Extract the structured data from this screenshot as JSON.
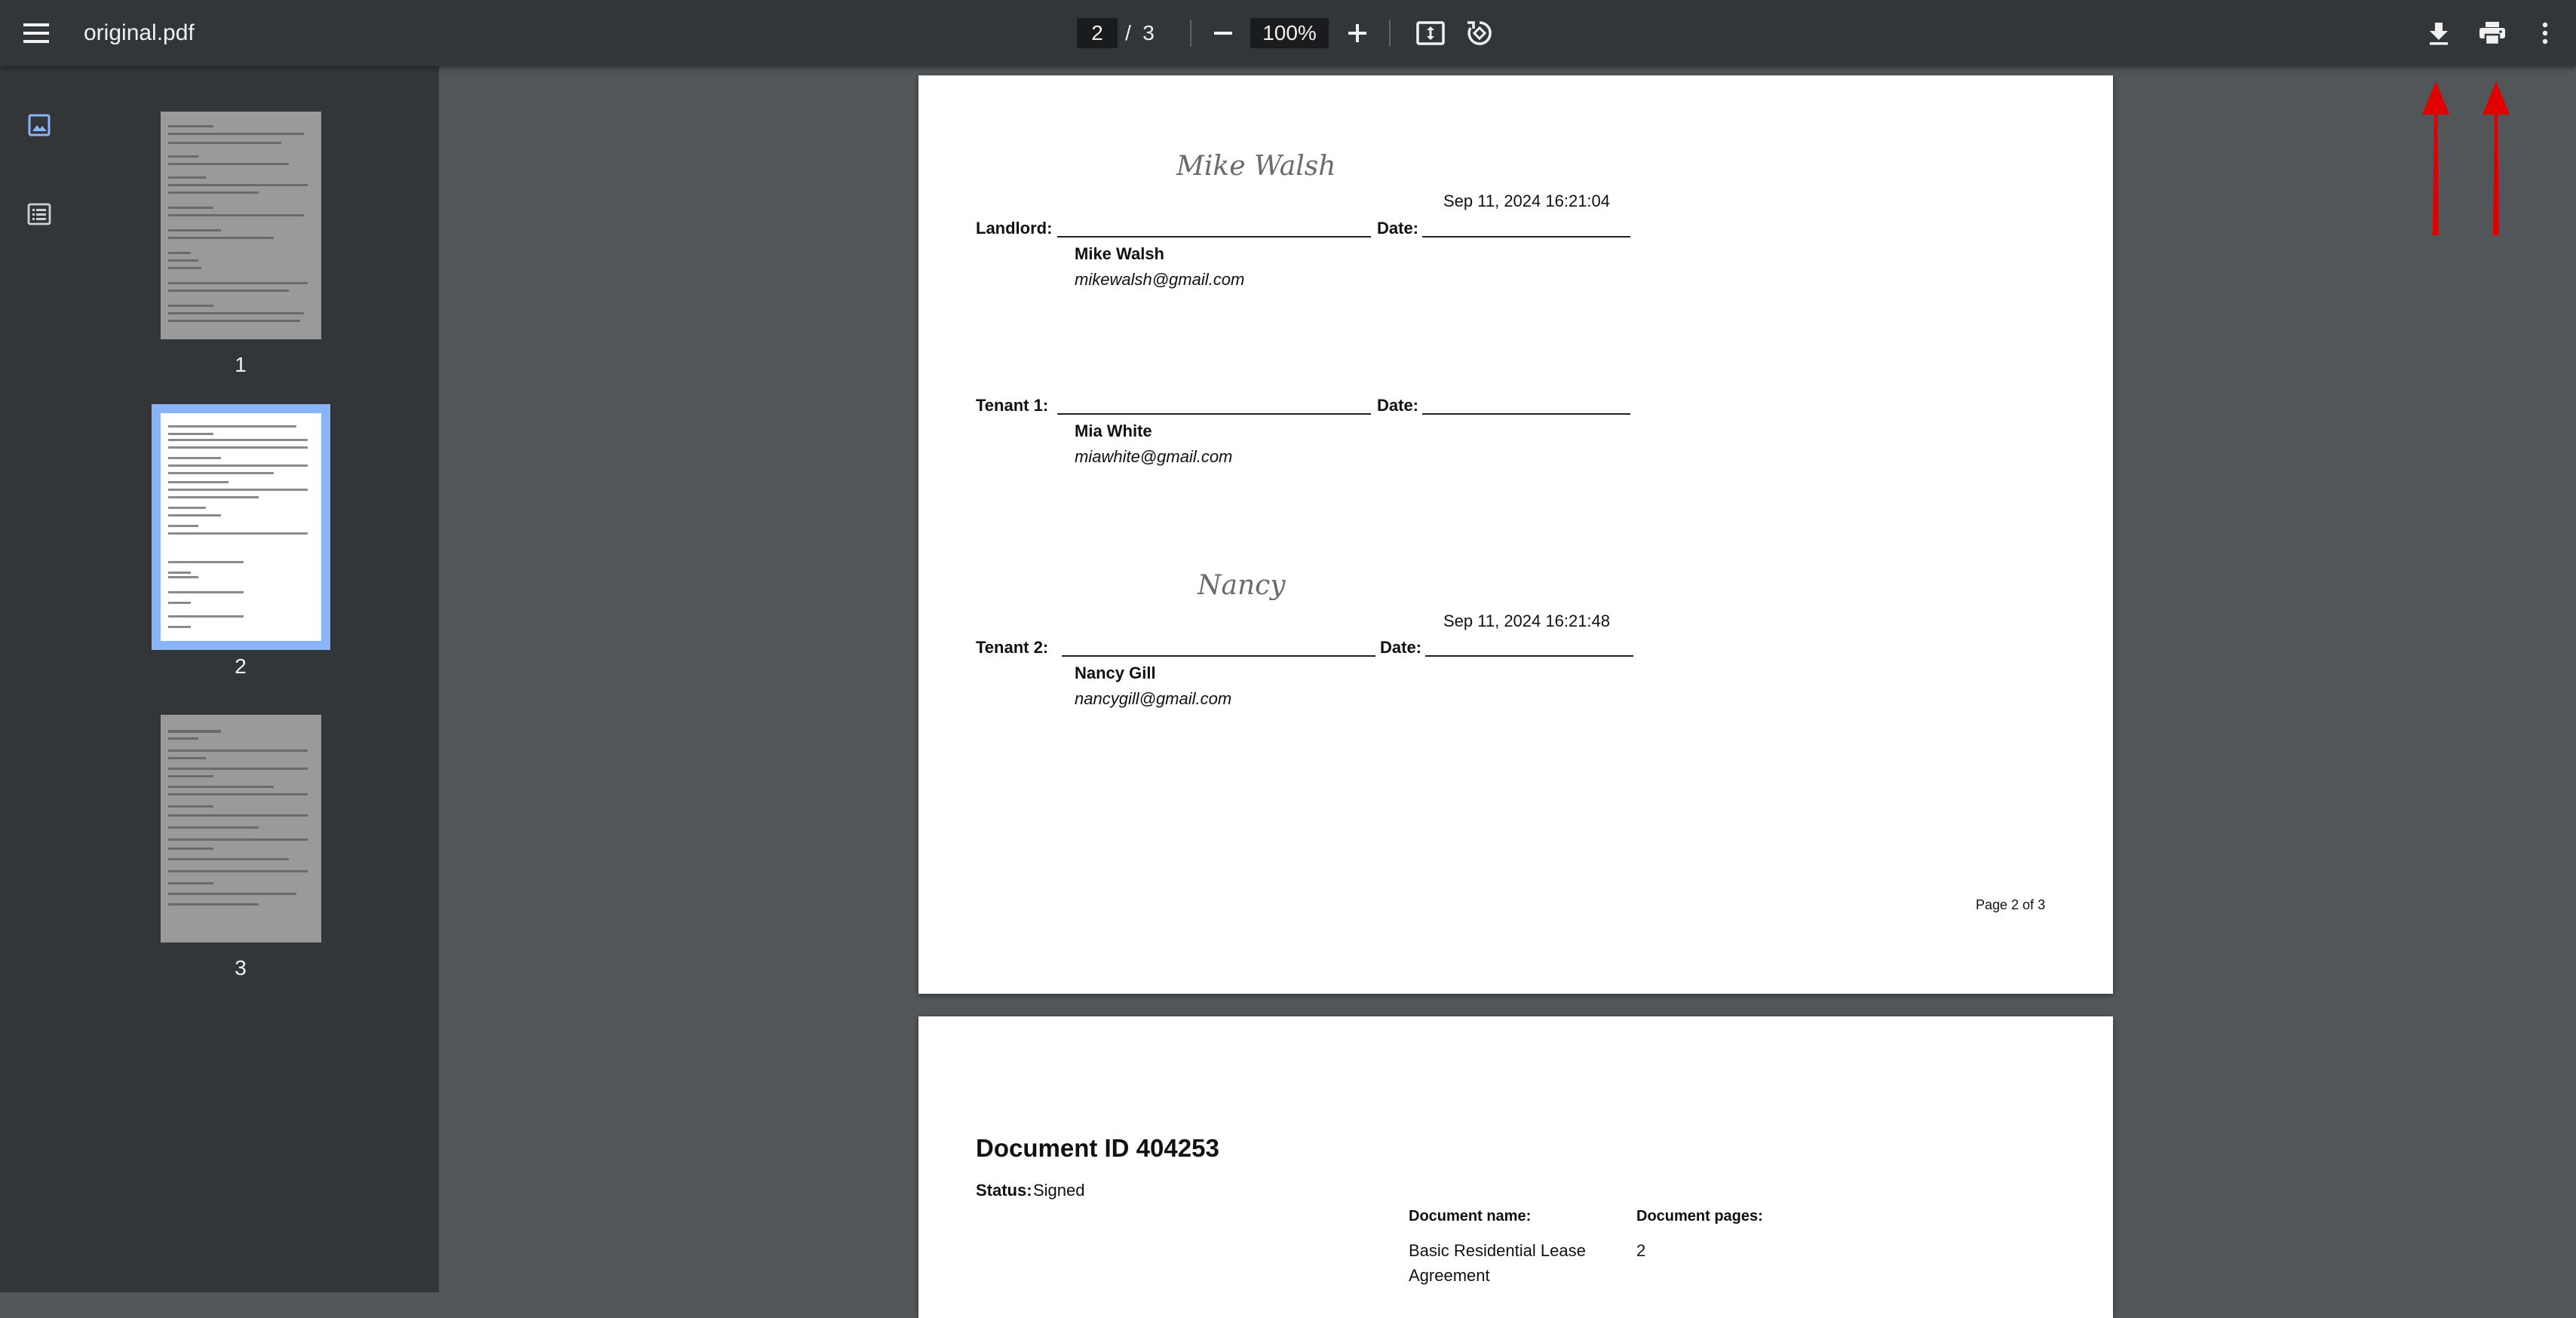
{
  "toolbar": {
    "title": "original.pdf",
    "page_current": "2",
    "page_separator": "/",
    "page_total": "3",
    "zoom": "100%",
    "icons": [
      "menu-icon",
      "minus-icon",
      "plus-icon",
      "fit-page-icon",
      "rotate-icon",
      "download-icon",
      "print-icon",
      "more-vert-icon"
    ]
  },
  "sidebar": {
    "tabs": [
      "thumbnails-icon",
      "outline-icon"
    ],
    "thumbnails": [
      {
        "label": "1",
        "selected": false
      },
      {
        "label": "2",
        "selected": true
      },
      {
        "label": "3",
        "selected": false
      }
    ]
  },
  "page2": {
    "landlord": {
      "role_label": "Landlord:",
      "date_label": "Date:",
      "signature": "Mike Walsh",
      "signed_date": "Sep 11, 2024 16:21:04",
      "name": "Mike Walsh",
      "email": "mikewalsh@gmail.com"
    },
    "tenant1": {
      "role_label": "Tenant 1:",
      "date_label": "Date:",
      "name": "Mia White",
      "email": "miawhite@gmail.com"
    },
    "tenant2": {
      "role_label": "Tenant 2:",
      "date_label": "Date:",
      "signature": "Nancy",
      "signed_date": "Sep 11, 2024 16:21:48",
      "name": "Nancy Gill",
      "email": "nancygill@gmail.com"
    },
    "footer": "Page 2 of 3"
  },
  "page3": {
    "heading": "Document ID 404253",
    "status_label": "Status:",
    "status_value": "Signed",
    "doc_name_label": "Document name:",
    "doc_name_line1": "Basic Residential Lease",
    "doc_name_line2": "Agreement",
    "doc_pages_label": "Document pages:",
    "doc_pages_value": "2"
  },
  "colors": {
    "toolbar": "#323639",
    "viewer_bg": "#525659",
    "selection": "#8ab4f8",
    "annotation_arrow": "#e00000"
  }
}
